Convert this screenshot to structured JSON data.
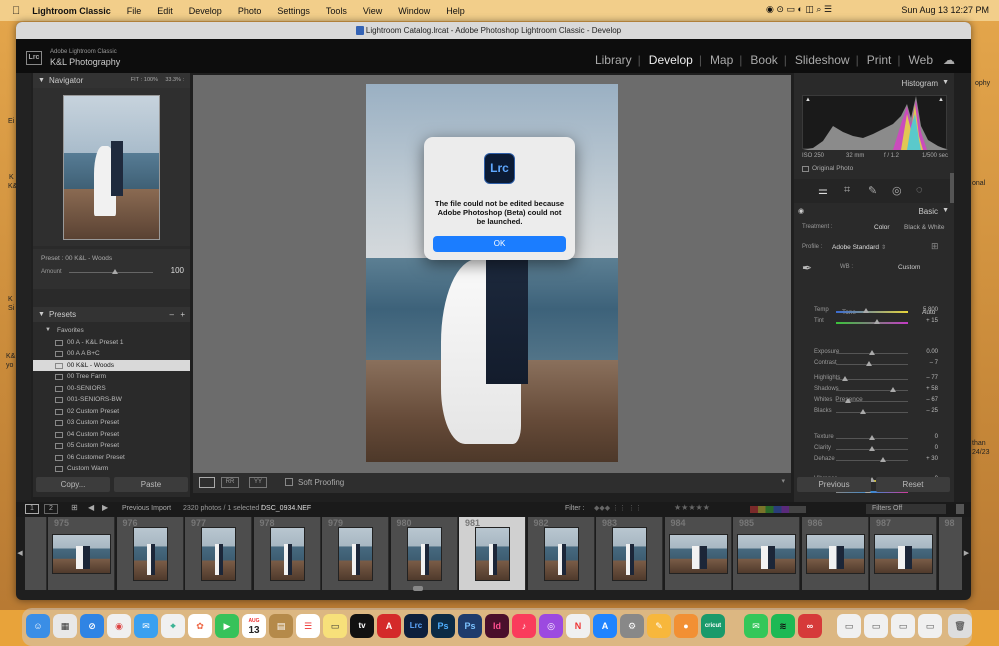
{
  "menubar": {
    "app_name": "Lightroom Classic",
    "items": [
      "File",
      "Edit",
      "Develop",
      "Photo",
      "Settings",
      "Tools",
      "View",
      "Window",
      "Help"
    ],
    "datetime": "Sun Aug 13  12:27 PM"
  },
  "window": {
    "title": "Lightroom Catalog.lrcat - Adobe Photoshop Lightroom Classic - Develop"
  },
  "identity": {
    "badge": "Lrc",
    "line1": "Adobe Lightroom Classic",
    "line2": "K&L Photography",
    "modules": [
      "Library",
      "Develop",
      "Map",
      "Book",
      "Slideshow",
      "Print",
      "Web"
    ],
    "active_module": "Develop"
  },
  "navigator": {
    "title": "Navigator",
    "zoom_options": [
      "FIT :",
      "100%",
      "33.3% :"
    ]
  },
  "preset_info": {
    "preset_label": "Preset : 00 K&L - Woods",
    "amount_label": "Amount",
    "amount_value": "100",
    "amount_level": 0.55
  },
  "presets": {
    "title": "Presets",
    "minus": "–",
    "plus": "+",
    "group": "Favorites",
    "items": [
      "00 A - K&L Preset 1",
      "00 A A B+C",
      "00 K&L - Woods",
      "00 Tree Farm",
      "00-SENIORS",
      "001-SENIORS-BW",
      "02 Custom Preset",
      "03 Custom Preset",
      "04 Custom Preset",
      "05 Custom Preset",
      "06 Customer Preset",
      "Custom Warm",
      "DB BW Edited"
    ],
    "selected_index": 2
  },
  "left_buttons": {
    "copy": "Copy...",
    "paste": "Paste"
  },
  "toolbar": {
    "soft_proofing": "Soft Proofing"
  },
  "dialog": {
    "logo": "Lrc",
    "message": "The file could not be edited because Adobe Photoshop (Beta) could not be launched.",
    "ok": "OK"
  },
  "histogram": {
    "title": "Histogram",
    "iso": "ISO 250",
    "focal": "32 mm",
    "aperture": "f / 1.2",
    "shutter": "1/500 sec",
    "original_photo": "Original Photo"
  },
  "basic": {
    "title": "Basic",
    "treatment_label": "Treatment :",
    "color": "Color",
    "bw": "Black & White",
    "profile_label": "Profile :",
    "profile_value": "Adobe Standard",
    "wb_label": "WB :",
    "wb_value": "Custom",
    "tone_label": "Tone",
    "auto": "Auto",
    "presence_label": "Presence",
    "sliders": [
      {
        "label": "Temp",
        "value": "5,800",
        "level": 0.41
      },
      {
        "label": "Tint",
        "value": "+ 15",
        "level": 0.57
      },
      {
        "label": "Exposure",
        "value": "0.00",
        "level": 0.5
      },
      {
        "label": "Contrast",
        "value": "– 7",
        "level": 0.46
      },
      {
        "label": "Highlights",
        "value": "– 77",
        "level": 0.12
      },
      {
        "label": "Shadows",
        "value": "+ 58",
        "level": 0.79
      },
      {
        "label": "Whites",
        "value": "– 67",
        "level": 0.17
      },
      {
        "label": "Blacks",
        "value": "– 25",
        "level": 0.38
      },
      {
        "label": "Texture",
        "value": "0",
        "level": 0.5
      },
      {
        "label": "Clarity",
        "value": "0",
        "level": 0.5
      },
      {
        "label": "Dehaze",
        "value": "+ 30",
        "level": 0.65
      },
      {
        "label": "Vibrance",
        "value": "0",
        "level": 0.5
      },
      {
        "label": "Saturation",
        "value": "– 10",
        "level": 0.45
      }
    ]
  },
  "right_buttons": {
    "previous": "Previous",
    "reset": "Reset"
  },
  "filmbar": {
    "view1": "1",
    "view2": "2",
    "source": "Previous Import",
    "count": "2320 photos / 1 selected /",
    "filename": "DSC_0934.NEF",
    "filter_label": "Filter :",
    "filters_off": "Filters Off"
  },
  "filmstrip": {
    "frames": [
      "975",
      "976",
      "977",
      "978",
      "979",
      "980",
      "981",
      "982",
      "983",
      "984",
      "985",
      "986",
      "987",
      "98"
    ],
    "selected_index": 6
  },
  "dock": {
    "calendar_month": "AUG",
    "calendar_day": "13",
    "tv": "tv",
    "lrc": "Lrc",
    "ps": "Ps",
    "id": "Id",
    "cricut": "cricut"
  },
  "desktop": {
    "left_snips": [
      "Ei",
      "K",
      "K&",
      "K",
      "Si",
      "K&",
      "yo"
    ],
    "right_snips": [
      "ophy",
      "onal",
      "than",
      "24/23"
    ]
  }
}
